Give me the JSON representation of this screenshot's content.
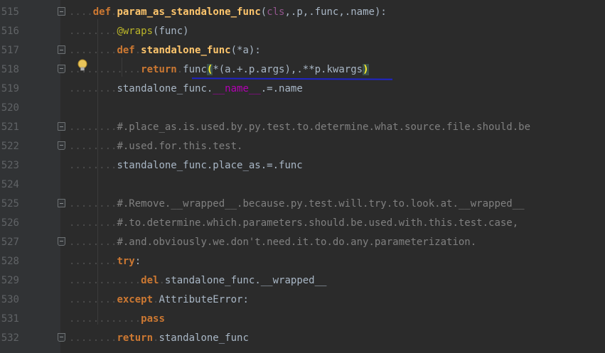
{
  "editor": {
    "lines": [
      {
        "num": "515",
        "indent": "....",
        "tokens": [
          {
            "t": "def",
            "c": "kw"
          },
          {
            "t": ".",
            "c": "dotsp"
          },
          {
            "t": "param_as_standalone_func",
            "c": "fn"
          },
          {
            "t": "(",
            "c": "pl"
          },
          {
            "t": "cls",
            "c": "self"
          },
          {
            "t": ",.",
            "c": "pl"
          },
          {
            "t": "p",
            "c": "pl"
          },
          {
            "t": ",.",
            "c": "pl"
          },
          {
            "t": "func",
            "c": "pl"
          },
          {
            "t": ",.",
            "c": "pl"
          },
          {
            "t": "name",
            "c": "pl"
          },
          {
            "t": "):",
            "c": "pl"
          }
        ]
      },
      {
        "num": "516",
        "indent": "........",
        "tokens": [
          {
            "t": "@wraps",
            "c": "deco"
          },
          {
            "t": "(func)",
            "c": "pl"
          }
        ]
      },
      {
        "num": "517",
        "indent": "........",
        "tokens": [
          {
            "t": "def",
            "c": "kw"
          },
          {
            "t": ".",
            "c": "dotsp"
          },
          {
            "t": "standalone_func",
            "c": "fn"
          },
          {
            "t": "(*a):",
            "c": "pl"
          }
        ]
      },
      {
        "num": "518",
        "indent": "............",
        "tokens": [
          {
            "t": "return",
            "c": "kw"
          },
          {
            "t": ".",
            "c": "dotsp"
          },
          {
            "t": "func",
            "c": "pl"
          },
          {
            "t": "(",
            "c": "paren-hl"
          },
          {
            "t": "*(a.+.p.args),.",
            "c": "pl"
          },
          {
            "t": "**p.kwargs",
            "c": "pl"
          },
          {
            "t": ")",
            "c": "paren-hl"
          }
        ]
      },
      {
        "num": "519",
        "indent": "........",
        "tokens": [
          {
            "t": "standalone_func.",
            "c": "pl"
          },
          {
            "t": "__name__",
            "c": "dunder"
          },
          {
            "t": ".=.",
            "c": "pl"
          },
          {
            "t": "name",
            "c": "pl"
          }
        ]
      },
      {
        "num": "520",
        "indent": "",
        "tokens": []
      },
      {
        "num": "521",
        "indent": "........",
        "tokens": [
          {
            "t": "#.place_as.is.used.by.py.test.to.determine.what.source.file.should.be",
            "c": "cmt"
          }
        ]
      },
      {
        "num": "522",
        "indent": "........",
        "tokens": [
          {
            "t": "#.used.for.this.test.",
            "c": "cmt"
          }
        ]
      },
      {
        "num": "523",
        "indent": "........",
        "tokens": [
          {
            "t": "standalone_func.place_as.=.func",
            "c": "pl"
          }
        ]
      },
      {
        "num": "524",
        "indent": "",
        "tokens": []
      },
      {
        "num": "525",
        "indent": "........",
        "tokens": [
          {
            "t": "#.Remove.__wrapped__.because.py.test.will.try.to.look.at.__wrapped__",
            "c": "cmt"
          }
        ]
      },
      {
        "num": "526",
        "indent": "........",
        "tokens": [
          {
            "t": "#.to.determine.which.parameters.should.be.used.with.this.test.case,",
            "c": "cmt"
          }
        ]
      },
      {
        "num": "527",
        "indent": "........",
        "tokens": [
          {
            "t": "#.and.obviously.we.don't.need.it.to.do.any.parameterization.",
            "c": "cmt"
          }
        ]
      },
      {
        "num": "528",
        "indent": "........",
        "tokens": [
          {
            "t": "try",
            "c": "kw"
          },
          {
            "t": ":",
            "c": "pl"
          }
        ]
      },
      {
        "num": "529",
        "indent": "............",
        "tokens": [
          {
            "t": "del",
            "c": "kw"
          },
          {
            "t": ".",
            "c": "dotsp"
          },
          {
            "t": "standalone_func.__wrapped__",
            "c": "pl"
          }
        ]
      },
      {
        "num": "530",
        "indent": "........",
        "tokens": [
          {
            "t": "except",
            "c": "kw"
          },
          {
            "t": ".",
            "c": "dotsp"
          },
          {
            "t": "AttributeError",
            "c": "pl"
          },
          {
            "t": ":",
            "c": "pl"
          }
        ]
      },
      {
        "num": "531",
        "indent": "............",
        "tokens": [
          {
            "t": "pass",
            "c": "kw"
          }
        ]
      },
      {
        "num": "532",
        "indent": "........",
        "tokens": [
          {
            "t": "return",
            "c": "kw"
          },
          {
            "t": ".",
            "c": "dotsp"
          },
          {
            "t": "standalone_func",
            "c": "pl"
          }
        ]
      }
    ],
    "colors": {
      "background": "#2b2b2b",
      "gutter": "#313335",
      "keyword": "#cc7832",
      "function": "#ffc66d",
      "comment": "#808080",
      "decorator": "#bbb529",
      "annotation_underline": "#1f24c9"
    },
    "icons": {
      "bulb": "intention-bulb-icon",
      "fold": "fold-marker-icon"
    }
  }
}
